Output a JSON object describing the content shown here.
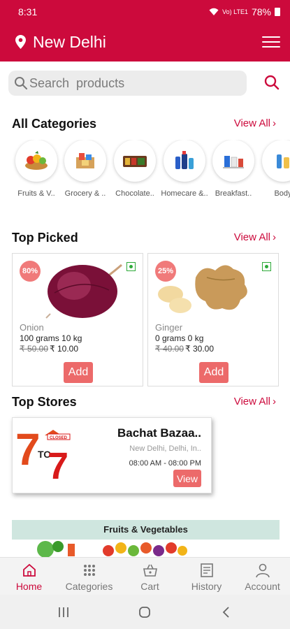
{
  "status_bar": {
    "time": "8:31",
    "network": "Vo) LTE1",
    "battery": "78%"
  },
  "header": {
    "location": "New Delhi"
  },
  "search": {
    "placeholder": "Search  products"
  },
  "categories_section": {
    "title": "All Categories",
    "view_all": "View All",
    "items": [
      {
        "label": "Fruits & V..",
        "icon": "fruits-vegetables-icon"
      },
      {
        "label": "Grocery & ..",
        "icon": "grocery-icon"
      },
      {
        "label": "Chocolate..",
        "icon": "chocolate-icon"
      },
      {
        "label": "Homecare &..",
        "icon": "homecare-icon"
      },
      {
        "label": "Breakfast..",
        "icon": "breakfast-icon"
      },
      {
        "label": "Body",
        "icon": "bodycare-icon"
      }
    ]
  },
  "top_picked": {
    "title": "Top Picked",
    "view_all": "View All",
    "products": [
      {
        "discount": "80%",
        "name": "Onion",
        "qty": "100 grams 10 kg",
        "old_price": "₹ 50.00",
        "price": "₹ 10.00",
        "add": "Add"
      },
      {
        "discount": "25%",
        "name": "Ginger",
        "qty": "0 grams 0 kg",
        "old_price": "₹ 40.00",
        "price": "₹ 30.00",
        "add": "Add"
      }
    ]
  },
  "top_stores": {
    "title": "Top Stores",
    "view_all": "View All",
    "store": {
      "name": "Bachat Bazaa..",
      "address": "New Delhi, Delhi, In..",
      "hours": "08:00 AM - 08:00 PM",
      "view": "View",
      "logo_text": {
        "big": "7",
        "mid": "TO",
        "small": "CLOSED"
      }
    }
  },
  "banner": {
    "title": "Fruits & Vegetables"
  },
  "bottom_nav": [
    {
      "label": "Home",
      "icon": "home-icon",
      "active": true
    },
    {
      "label": "Categories",
      "icon": "grid-icon",
      "active": false
    },
    {
      "label": "Cart",
      "icon": "basket-icon",
      "active": false
    },
    {
      "label": "History",
      "icon": "receipt-icon",
      "active": false
    },
    {
      "label": "Account",
      "icon": "person-icon",
      "active": false
    }
  ],
  "colors": {
    "brand": "#cc0a3c",
    "accent": "#ec6a6a",
    "veg": "#2eaa3a"
  }
}
